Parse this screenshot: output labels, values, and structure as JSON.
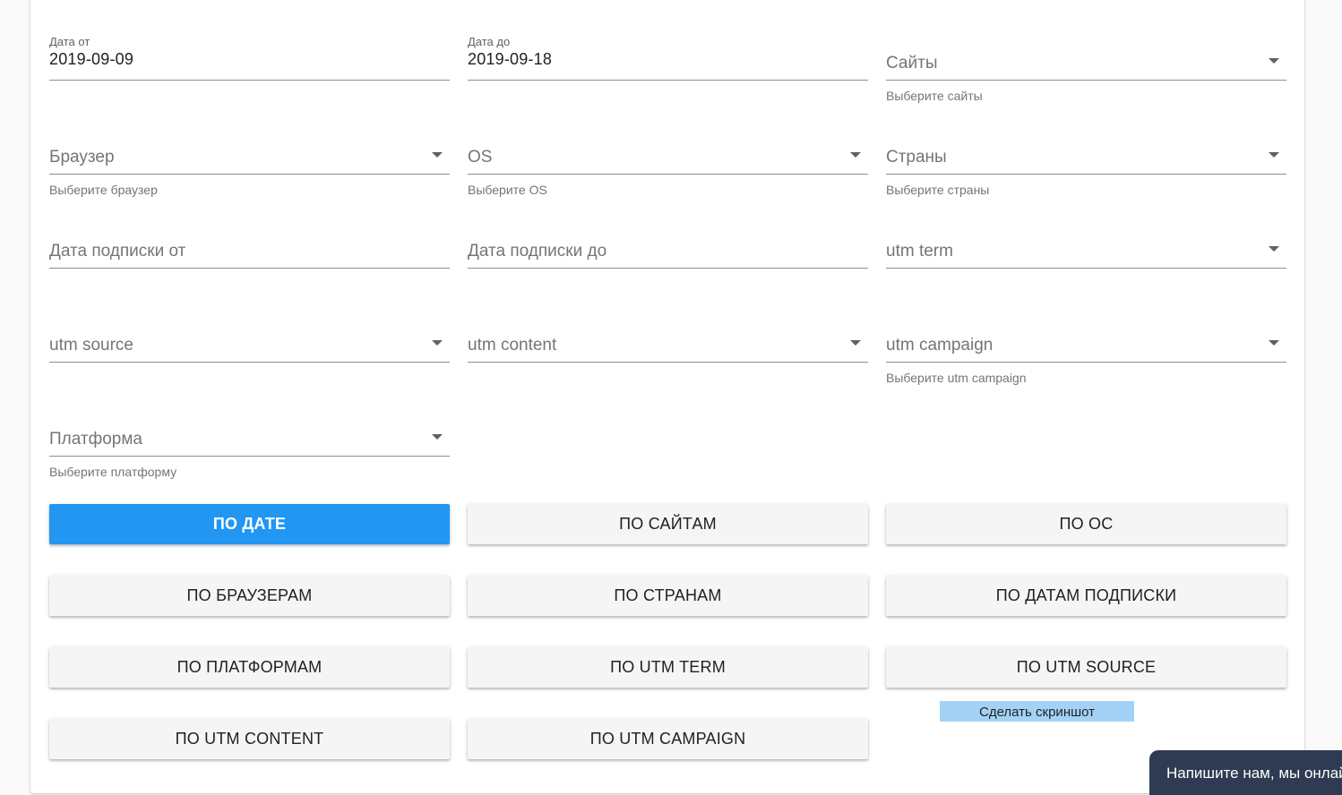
{
  "filters": {
    "date_from": {
      "label": "Дата от",
      "value": "2019-09-09"
    },
    "date_to": {
      "label": "Дата до",
      "value": "2019-09-18"
    },
    "sites": {
      "placeholder": "Сайты",
      "hint": "Выберите сайты"
    },
    "browser": {
      "placeholder": "Браузер",
      "hint": "Выберите браузер"
    },
    "os": {
      "placeholder": "OS",
      "hint": "Выберите OS"
    },
    "countries": {
      "placeholder": "Страны",
      "hint": "Выберите страны"
    },
    "sub_date_from": {
      "placeholder": "Дата подписки от"
    },
    "sub_date_to": {
      "placeholder": "Дата подписки до"
    },
    "utm_term": {
      "placeholder": "utm term"
    },
    "utm_source": {
      "placeholder": "utm source"
    },
    "utm_content": {
      "placeholder": "utm content"
    },
    "utm_campaign": {
      "placeholder": "utm campaign",
      "hint": "Выберите utm campaign"
    },
    "platform": {
      "placeholder": "Платформа",
      "hint": "Выберите платформу"
    }
  },
  "buttons": {
    "by_date": "ПО ДАТЕ",
    "by_sites": "ПО САЙТАМ",
    "by_os": "ПО ОС",
    "by_browsers": "ПО БРАУЗЕРАМ",
    "by_countries": "ПО СТРАНАМ",
    "by_sub_dates": "ПО ДАТАМ ПОДПИСКИ",
    "by_platforms": "ПО ПЛАТФОРМАМ",
    "by_utm_term": "ПО UTM TERM",
    "by_utm_source": "ПО UTM SOURCE",
    "by_utm_content": "ПО UTM CONTENT",
    "by_utm_campaign": "ПО UTM CAMPAIGN"
  },
  "screenshot_label": "Сделать скриншот",
  "chat_label": "Напишите нам, мы онлайн!",
  "colors": {
    "primary": "#2196f3",
    "button_bg": "#f5f5f5",
    "screenshot_bg": "#a4d2f6",
    "chat_bg": "#2f3b52"
  }
}
